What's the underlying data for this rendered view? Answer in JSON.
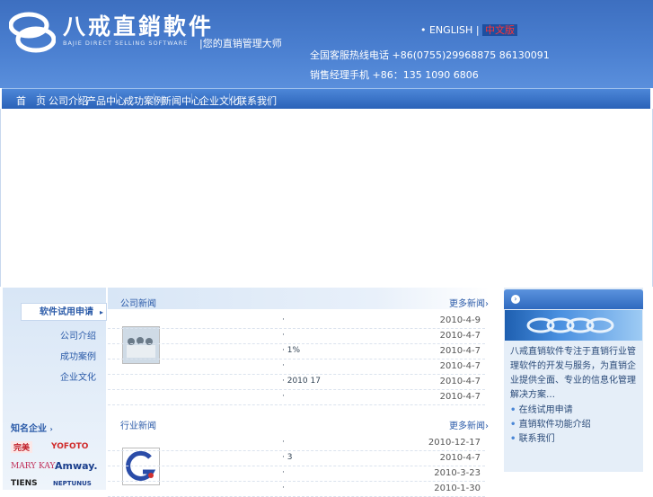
{
  "header": {
    "logo_cn": "八戒直銷軟件",
    "logo_en": "BAJIE DIRECT SELLING SOFTWARE",
    "slogan": "|您的直销管理大师",
    "lang_en": "• ENGLISH",
    "lang_sep": "|",
    "lang_cn": "中文版",
    "phone_label": "全国客服热线电话",
    "phone": "+86(0755)29968875 86130091",
    "mobile_label": "销售经理手机",
    "mobile": "+86：135 1090 6806"
  },
  "nav": {
    "items": [
      "首　页",
      "公司介绍",
      "产品中心",
      "成功案例",
      "新闻中心",
      "企业文化",
      "联系我们"
    ]
  },
  "sidebar": {
    "active": "软件试用申请",
    "links": [
      "公司介绍",
      "成功案例",
      "企业文化"
    ],
    "famous_title": "知名企业",
    "brands": [
      "完美",
      "YOFOTO",
      "MARY KAY",
      "Amway.",
      "TIENS",
      "NEPTUNUS"
    ]
  },
  "news1": {
    "title": "公司新闻",
    "more": "更多新闻",
    "rows": [
      {
        "text": "·",
        "date": "2010-4-9"
      },
      {
        "text": "·",
        "date": "2010-4-7"
      },
      {
        "text": "·              1%",
        "date": "2010-4-7"
      },
      {
        "text": "·",
        "date": "2010-4-7"
      },
      {
        "text": "·  2010        17",
        "date": "2010-4-7"
      },
      {
        "text": "·",
        "date": "2010-4-7"
      }
    ]
  },
  "news2": {
    "title": "行业新闻",
    "more": "更多新闻",
    "rows": [
      {
        "text": "·",
        "date": "2010-12-17"
      },
      {
        "text": "·              3",
        "date": "2010-4-7"
      },
      {
        "text": "·",
        "date": "2010-3-23"
      },
      {
        "text": "·",
        "date": "2010-1-30"
      }
    ]
  },
  "right_panel": {
    "text": "八戒直销软件专注于直销行业管理软件的开发与服务，为直销企业提供全面、专业的信息化管理解决方案…",
    "links": [
      "在线试用申请",
      "直销软件功能介绍",
      "联系我们"
    ]
  },
  "colors": {
    "brand_blue": "#3d6fc0",
    "nav_blue": "#2a62b8",
    "accent_red": "#ff3333"
  }
}
